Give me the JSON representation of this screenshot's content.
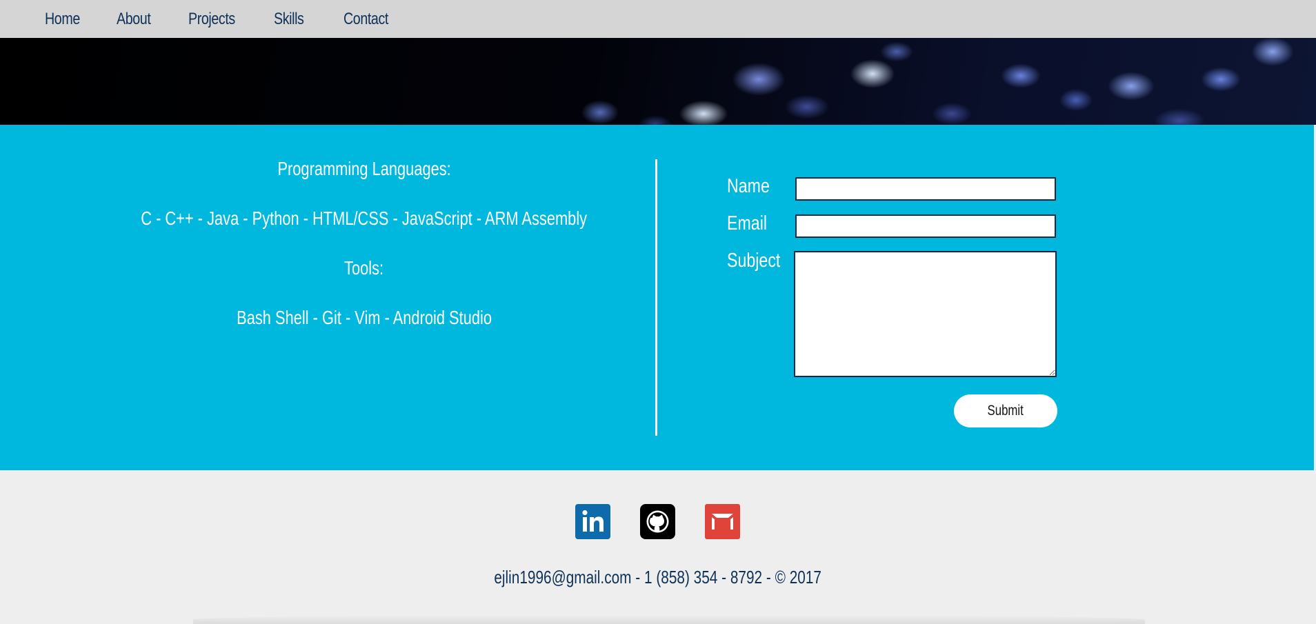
{
  "nav": {
    "items": [
      {
        "label": "Home"
      },
      {
        "label": "About"
      },
      {
        "label": "Projects"
      },
      {
        "label": "Skills"
      },
      {
        "label": "Contact"
      }
    ]
  },
  "skills": {
    "languages_heading": "Programming Languages:",
    "languages": "C - C++ - Java - Python - HTML/CSS - JavaScript - ARM Assembly",
    "tools_heading": "Tools:",
    "tools": "Bash Shell - Git - Vim - Android Studio"
  },
  "contact_form": {
    "name_label": "Name",
    "name_value": "",
    "email_label": "Email",
    "email_value": "",
    "subject_label": "Subject",
    "subject_value": "",
    "submit_label": "Submit"
  },
  "footer": {
    "social": [
      {
        "name": "linkedin-icon",
        "color": "#0e6bab"
      },
      {
        "name": "github-icon",
        "color": "#000000"
      },
      {
        "name": "gmail-icon",
        "color": "#e0433a"
      }
    ],
    "contact_line": "ejlin1996@gmail.com - 1 (858) 354 - 8792 - © 2017"
  },
  "colors": {
    "band": "#00b8de",
    "nav_text": "#0e3157",
    "footer_bg": "#eeeeee"
  }
}
